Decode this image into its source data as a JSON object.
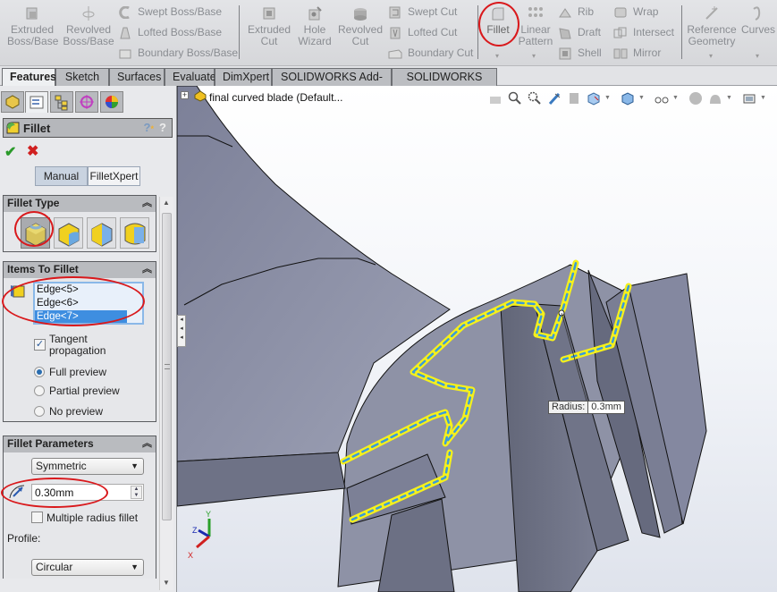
{
  "ribbon": {
    "extruded_boss": "Extruded\nBoss/Base",
    "extruded_boss_l1": "Extruded",
    "extruded_boss_l2": "Boss/Base",
    "revolved_boss_l1": "Revolved",
    "revolved_boss_l2": "Boss/Base",
    "swept_boss": "Swept Boss/Base",
    "lofted_boss": "Lofted Boss/Base",
    "boundary_boss": "Boundary Boss/Base",
    "extruded_cut_l1": "Extruded",
    "extruded_cut_l2": "Cut",
    "hole_wizard_l1": "Hole",
    "hole_wizard_l2": "Wizard",
    "revolved_cut_l1": "Revolved",
    "revolved_cut_l2": "Cut",
    "swept_cut": "Swept Cut",
    "lofted_cut": "Lofted Cut",
    "boundary_cut": "Boundary Cut",
    "fillet": "Fillet",
    "linear_pattern_l1": "Linear",
    "linear_pattern_l2": "Pattern",
    "rib": "Rib",
    "draft": "Draft",
    "shell": "Shell",
    "wrap": "Wrap",
    "intersect": "Intersect",
    "mirror": "Mirror",
    "reference_geometry_l1": "Reference",
    "reference_geometry_l2": "Geometry",
    "curves": "Curves"
  },
  "tabs": [
    {
      "label": "Features",
      "active": true
    },
    {
      "label": "Sketch"
    },
    {
      "label": "Surfaces"
    },
    {
      "label": "Evaluate"
    },
    {
      "label": "DimXpert"
    },
    {
      "label": "SOLIDWORKS Add-Ins"
    },
    {
      "label": "SOLIDWORKS MBD"
    }
  ],
  "property_manager": {
    "title": "Fillet",
    "modes": {
      "manual": "Manual",
      "filletxpert": "FilletXpert",
      "selected": "Manual"
    },
    "fillet_type": {
      "header": "Fillet Type",
      "options": [
        "Constant size fillet",
        "Variable size fillet",
        "Face fillet",
        "Full round fillet"
      ],
      "selected_index": 0
    },
    "items_to_fillet": {
      "header": "Items To Fillet",
      "edges": [
        "Edge<5>",
        "Edge<6>",
        "Edge<7>"
      ],
      "selected": "Edge<7>",
      "tangent_propagation": {
        "label": "Tangent propagation",
        "l1": "Tangent",
        "l2": "propagation",
        "checked": true
      },
      "preview_options": [
        {
          "label": "Full preview",
          "selected": true
        },
        {
          "label": "Partial preview",
          "selected": false
        },
        {
          "label": "No preview",
          "selected": false
        }
      ]
    },
    "fillet_parameters": {
      "header": "Fillet Parameters",
      "method": "Symmetric",
      "radius": "0.30mm",
      "multiple_radius": {
        "label": "Multiple radius fillet",
        "checked": false
      },
      "profile_label": "Profile:",
      "profile": "Circular"
    }
  },
  "viewport": {
    "document_title": "final curved blade  (Default...",
    "radius_callout": {
      "label": "Radius:",
      "value": "0.3mm"
    },
    "triad": {
      "x": "X",
      "y": "Y",
      "z": "Z"
    }
  },
  "colors": {
    "highlight_ring": "#d9191c",
    "selection_yellow": "#f5f01c",
    "selection_blue": "#3a9bd9",
    "model_gray": "#8a8ea3",
    "list_selected": "#3e8ee0"
  }
}
